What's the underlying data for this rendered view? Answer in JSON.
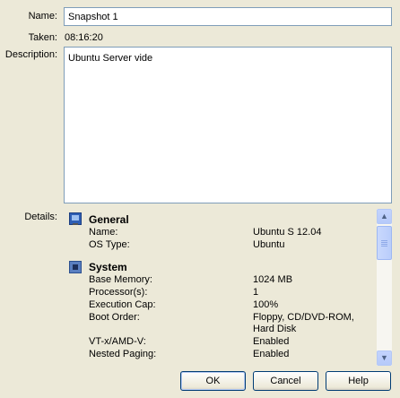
{
  "form": {
    "name_label": "Name:",
    "name_value": "Snapshot 1",
    "taken_label": "Taken:",
    "taken_value": "08:16:20",
    "description_label": "Description:",
    "description_value": "Ubuntu Server vide",
    "details_label": "Details:"
  },
  "details": {
    "general": {
      "title": "General",
      "icon": "monitor-icon",
      "rows": [
        {
          "key": "Name:",
          "value": "Ubuntu S 12.04"
        },
        {
          "key": "OS Type:",
          "value": "Ubuntu"
        }
      ]
    },
    "system": {
      "title": "System",
      "icon": "chip-icon",
      "rows": [
        {
          "key": "Base Memory:",
          "value": "1024 MB"
        },
        {
          "key": "Processor(s):",
          "value": "1"
        },
        {
          "key": "Execution Cap:",
          "value": "100%"
        },
        {
          "key": "Boot Order:",
          "value": "Floppy, CD/DVD-ROM,"
        },
        {
          "key": "",
          "value": "Hard Disk"
        },
        {
          "key": "VT-x/AMD-V:",
          "value": "Enabled"
        },
        {
          "key": "Nested Paging:",
          "value": "Enabled"
        }
      ]
    }
  },
  "buttons": {
    "ok": "OK",
    "cancel": "Cancel",
    "help": "Help"
  },
  "scrollbar": {
    "up_icon": "▲",
    "down_icon": "▼"
  },
  "colors": {
    "accent": "#003c74",
    "dialog_bg": "#ece9d8"
  }
}
